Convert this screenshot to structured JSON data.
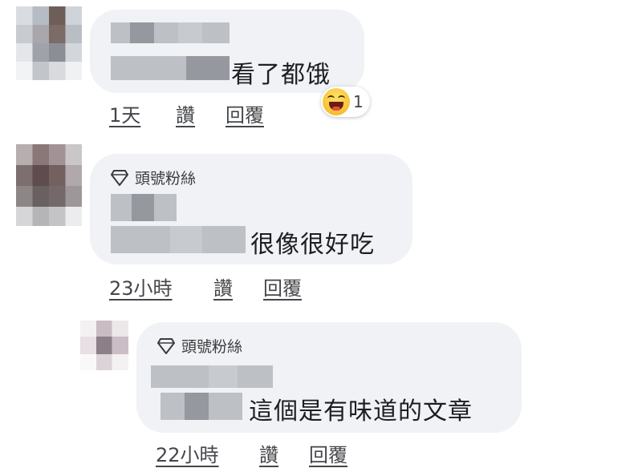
{
  "comments": [
    {
      "badge": "",
      "text": "看了都饿",
      "time": "1天",
      "like": "讚",
      "reply": "回覆",
      "reaction_count": "1"
    },
    {
      "badge": "頭號粉絲",
      "text": "很像很好吃",
      "time": "23小時",
      "like": "讚",
      "reply": "回覆"
    },
    {
      "badge": "頭號粉絲",
      "text": "這個是有味道的文章",
      "time": "22小時",
      "like": "讚",
      "reply": "回覆"
    }
  ],
  "icons": {
    "badge_icon": "diamond-icon",
    "reaction_icon": "haha-reaction-icon"
  },
  "colors": {
    "bubble": "#f0f2f5",
    "action_text": "#44464a"
  }
}
